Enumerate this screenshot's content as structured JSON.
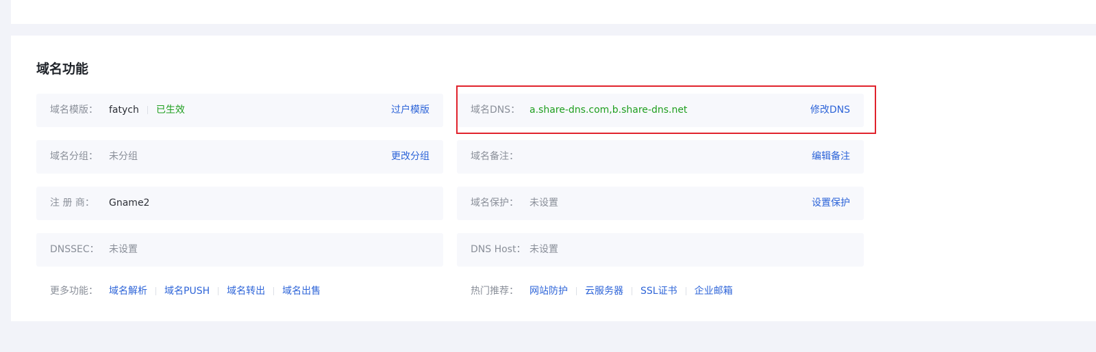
{
  "section": {
    "title": "域名功能"
  },
  "left_rows": [
    {
      "label": "域名模版：",
      "value": "fatych",
      "status": "已生效",
      "action": "过户模版"
    },
    {
      "label": "域名分组：",
      "value": "未分组",
      "action": "更改分组"
    },
    {
      "label": "注 册 商：",
      "value": "Gname2"
    },
    {
      "label": "DNSSEC：",
      "value": "未设置"
    }
  ],
  "right_rows": [
    {
      "label": "域名DNS：",
      "value": "a.share-dns.com,b.share-dns.net",
      "action": "修改DNS"
    },
    {
      "label": "域名备注：",
      "value": "",
      "action": "编辑备注"
    },
    {
      "label": "域名保护：",
      "value": "未设置",
      "action": "设置保护"
    },
    {
      "label": "DNS Host：",
      "value": "未设置"
    }
  ],
  "more_features": {
    "label": "更多功能：",
    "links": [
      "域名解析",
      "域名PUSH",
      "域名转出",
      "域名出售"
    ]
  },
  "hot_recommend": {
    "label": "热门推荐：",
    "links": [
      "网站防护",
      "云服务器",
      "SSL证书",
      "企业邮箱"
    ]
  },
  "colors": {
    "link": "#2d64d8",
    "success": "#1e9e1e",
    "highlight": "#e0212b",
    "background": "#f2f3f9"
  }
}
